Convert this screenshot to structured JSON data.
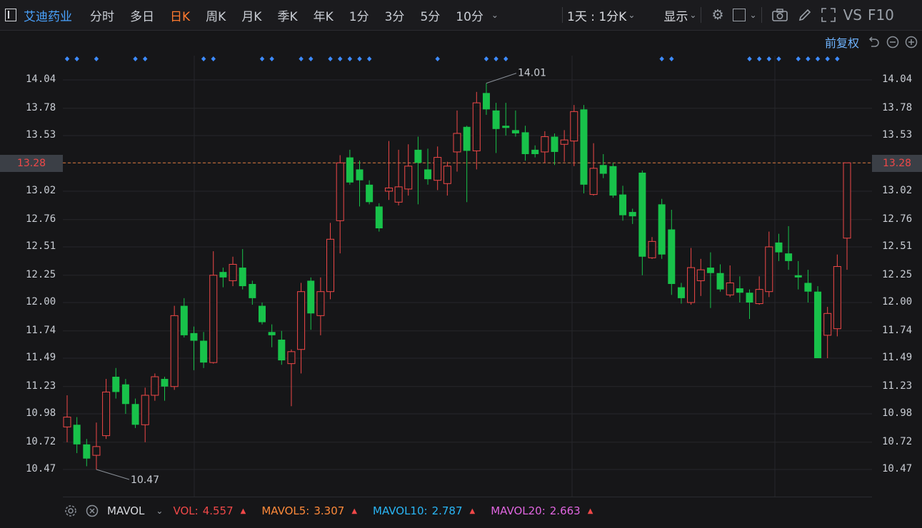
{
  "toolbar": {
    "stock_name": "艾迪药业",
    "tabs": [
      {
        "label": "分时",
        "active": false
      },
      {
        "label": "多日",
        "active": false
      },
      {
        "label": "日K",
        "active": true
      },
      {
        "label": "周K",
        "active": false
      },
      {
        "label": "月K",
        "active": false
      },
      {
        "label": "季K",
        "active": false
      },
      {
        "label": "年K",
        "active": false
      },
      {
        "label": "1分",
        "active": false
      },
      {
        "label": "3分",
        "active": false
      },
      {
        "label": "5分",
        "active": false
      },
      {
        "label": "10分",
        "active": false
      }
    ],
    "interval_select": "1天 : 1分K",
    "display_label": "显示",
    "vs_label": "VS",
    "f10_label": "F10"
  },
  "sub_toolbar": {
    "adjust_label": "前复权"
  },
  "colors": {
    "up": "#f04848",
    "down": "#18c24a",
    "accent": "#4aa3ff",
    "active_tab": "#ff7a2f",
    "dashed_line": "#e07a3c"
  },
  "chart": {
    "y_ticks": [
      "14.04",
      "13.78",
      "13.53",
      "13.28",
      "13.02",
      "12.76",
      "12.51",
      "12.25",
      "12.00",
      "11.74",
      "11.49",
      "11.23",
      "10.98",
      "10.72",
      "10.47"
    ],
    "y_min_value": 10.47,
    "y_max_value": 14.04,
    "current_price": "13.28",
    "max_annotation": "14.01",
    "min_annotation": "10.47"
  },
  "chart_data": {
    "type": "candlestick",
    "title": "",
    "ylim": [
      10.47,
      14.04
    ],
    "candles": [
      {
        "o": 10.86,
        "c": 10.95,
        "h": 11.15,
        "l": 10.72
      },
      {
        "o": 10.88,
        "c": 10.7,
        "h": 10.95,
        "l": 10.62
      },
      {
        "o": 10.7,
        "c": 10.57,
        "h": 10.75,
        "l": 10.5
      },
      {
        "o": 10.6,
        "c": 10.68,
        "h": 10.9,
        "l": 10.47
      },
      {
        "o": 10.78,
        "c": 11.18,
        "h": 11.3,
        "l": 10.75
      },
      {
        "o": 11.32,
        "c": 11.18,
        "h": 11.4,
        "l": 11.12
      },
      {
        "o": 11.25,
        "c": 11.07,
        "h": 11.3,
        "l": 10.98
      },
      {
        "o": 11.07,
        "c": 10.88,
        "h": 11.12,
        "l": 10.85
      },
      {
        "o": 10.88,
        "c": 11.15,
        "h": 11.22,
        "l": 10.72
      },
      {
        "o": 11.15,
        "c": 11.32,
        "h": 11.35,
        "l": 11.1
      },
      {
        "o": 11.3,
        "c": 11.23,
        "h": 11.32,
        "l": 11.1
      },
      {
        "o": 11.23,
        "c": 11.88,
        "h": 11.97,
        "l": 11.2
      },
      {
        "o": 11.97,
        "c": 11.7,
        "h": 12.04,
        "l": 11.68
      },
      {
        "o": 11.72,
        "c": 11.65,
        "h": 11.78,
        "l": 11.38
      },
      {
        "o": 11.65,
        "c": 11.45,
        "h": 11.73,
        "l": 11.4
      },
      {
        "o": 11.45,
        "c": 12.25,
        "h": 12.47,
        "l": 11.44
      },
      {
        "o": 12.28,
        "c": 12.23,
        "h": 12.32,
        "l": 12.14
      },
      {
        "o": 12.2,
        "c": 12.35,
        "h": 12.42,
        "l": 12.15
      },
      {
        "o": 12.32,
        "c": 12.15,
        "h": 12.49,
        "l": 12.12
      },
      {
        "o": 12.17,
        "c": 12.04,
        "h": 12.2,
        "l": 11.98
      },
      {
        "o": 11.97,
        "c": 11.82,
        "h": 12.0,
        "l": 11.8
      },
      {
        "o": 11.73,
        "c": 11.7,
        "h": 11.8,
        "l": 11.59
      },
      {
        "o": 11.66,
        "c": 11.47,
        "h": 11.74,
        "l": 11.43
      },
      {
        "o": 11.44,
        "c": 11.55,
        "h": 11.57,
        "l": 11.05
      },
      {
        "o": 11.57,
        "c": 12.1,
        "h": 12.18,
        "l": 11.35
      },
      {
        "o": 12.2,
        "c": 11.9,
        "h": 12.23,
        "l": 11.75
      },
      {
        "o": 11.88,
        "c": 12.1,
        "h": 12.23,
        "l": 11.7
      },
      {
        "o": 12.1,
        "c": 12.58,
        "h": 12.73,
        "l": 12.03
      },
      {
        "o": 12.75,
        "c": 13.28,
        "h": 13.35,
        "l": 12.45
      },
      {
        "o": 13.33,
        "c": 13.1,
        "h": 13.4,
        "l": 13.08
      },
      {
        "o": 13.22,
        "c": 13.12,
        "h": 13.3,
        "l": 12.88
      },
      {
        "o": 13.08,
        "c": 12.92,
        "h": 13.12,
        "l": 12.9
      },
      {
        "o": 12.88,
        "c": 12.68,
        "h": 12.91,
        "l": 12.65
      },
      {
        "o": 13.02,
        "c": 13.05,
        "h": 13.48,
        "l": 12.94
      },
      {
        "o": 12.92,
        "c": 13.06,
        "h": 13.4,
        "l": 12.89
      },
      {
        "o": 13.04,
        "c": 13.25,
        "h": 13.45,
        "l": 12.98
      },
      {
        "o": 13.4,
        "c": 13.28,
        "h": 13.52,
        "l": 12.9
      },
      {
        "o": 13.22,
        "c": 13.13,
        "h": 13.41,
        "l": 13.08
      },
      {
        "o": 13.12,
        "c": 13.33,
        "h": 13.43,
        "l": 13.03
      },
      {
        "o": 13.09,
        "c": 13.25,
        "h": 13.29,
        "l": 12.98
      },
      {
        "o": 13.38,
        "c": 13.55,
        "h": 13.76,
        "l": 13.2
      },
      {
        "o": 13.61,
        "c": 13.39,
        "h": 13.62,
        "l": 12.92
      },
      {
        "o": 13.39,
        "c": 13.83,
        "h": 13.93,
        "l": 13.22
      },
      {
        "o": 13.92,
        "c": 13.77,
        "h": 14.01,
        "l": 13.72
      },
      {
        "o": 13.76,
        "c": 13.59,
        "h": 13.83,
        "l": 13.37
      },
      {
        "o": 13.62,
        "c": 13.6,
        "h": 13.83,
        "l": 13.53
      },
      {
        "o": 13.58,
        "c": 13.55,
        "h": 13.76,
        "l": 13.52
      },
      {
        "o": 13.56,
        "c": 13.36,
        "h": 13.62,
        "l": 13.3
      },
      {
        "o": 13.4,
        "c": 13.36,
        "h": 13.44,
        "l": 13.33
      },
      {
        "o": 13.38,
        "c": 13.52,
        "h": 13.57,
        "l": 13.28
      },
      {
        "o": 13.52,
        "c": 13.38,
        "h": 13.55,
        "l": 13.26
      },
      {
        "o": 13.45,
        "c": 13.49,
        "h": 13.58,
        "l": 13.29
      },
      {
        "o": 13.48,
        "c": 13.75,
        "h": 13.81,
        "l": 13.25
      },
      {
        "o": 13.77,
        "c": 13.08,
        "h": 13.81,
        "l": 13.0
      },
      {
        "o": 12.99,
        "c": 13.23,
        "h": 13.46,
        "l": 12.98
      },
      {
        "o": 13.26,
        "c": 13.18,
        "h": 13.36,
        "l": 13.14
      },
      {
        "o": 13.25,
        "c": 12.98,
        "h": 13.28,
        "l": 12.96
      },
      {
        "o": 12.99,
        "c": 12.8,
        "h": 13.07,
        "l": 12.75
      },
      {
        "o": 12.83,
        "c": 12.79,
        "h": 12.86,
        "l": 12.72
      },
      {
        "o": 13.19,
        "c": 12.42,
        "h": 13.21,
        "l": 12.25
      },
      {
        "o": 12.41,
        "c": 12.56,
        "h": 12.6,
        "l": 12.4
      },
      {
        "o": 12.9,
        "c": 12.44,
        "h": 12.95,
        "l": 12.4
      },
      {
        "o": 12.67,
        "c": 12.17,
        "h": 12.85,
        "l": 12.07
      },
      {
        "o": 12.14,
        "c": 12.04,
        "h": 12.18,
        "l": 11.99
      },
      {
        "o": 12.0,
        "c": 12.32,
        "h": 12.5,
        "l": 11.98
      },
      {
        "o": 12.2,
        "c": 12.3,
        "h": 12.4,
        "l": 12.06
      },
      {
        "o": 12.32,
        "c": 12.27,
        "h": 12.46,
        "l": 11.95
      },
      {
        "o": 12.27,
        "c": 12.12,
        "h": 12.35,
        "l": 12.1
      },
      {
        "o": 12.07,
        "c": 12.18,
        "h": 12.34,
        "l": 12.05
      },
      {
        "o": 12.13,
        "c": 12.09,
        "h": 12.24,
        "l": 12.0
      },
      {
        "o": 12.09,
        "c": 12.0,
        "h": 12.12,
        "l": 11.85
      },
      {
        "o": 11.99,
        "c": 12.12,
        "h": 12.24,
        "l": 11.98
      },
      {
        "o": 12.1,
        "c": 12.51,
        "h": 12.65,
        "l": 12.05
      },
      {
        "o": 12.55,
        "c": 12.46,
        "h": 12.63,
        "l": 12.38
      },
      {
        "o": 12.45,
        "c": 12.38,
        "h": 12.7,
        "l": 12.3
      },
      {
        "o": 12.25,
        "c": 12.23,
        "h": 12.38,
        "l": 12.12
      },
      {
        "o": 12.18,
        "c": 12.1,
        "h": 12.3,
        "l": 12.0
      },
      {
        "o": 12.1,
        "c": 11.49,
        "h": 12.15,
        "l": 11.49
      },
      {
        "o": 11.7,
        "c": 11.9,
        "h": 11.96,
        "l": 11.49
      },
      {
        "o": 11.76,
        "c": 12.33,
        "h": 12.44,
        "l": 11.69
      },
      {
        "o": 12.59,
        "c": 13.28,
        "h": 13.28,
        "l": 12.3
      }
    ]
  },
  "markers": {
    "indices": [
      0,
      1,
      3,
      7,
      8,
      14,
      15,
      20,
      21,
      24,
      25,
      27,
      28,
      29,
      30,
      31,
      38,
      43,
      44,
      45,
      61,
      62,
      70,
      71,
      72,
      73,
      75,
      76,
      77,
      78,
      79
    ]
  },
  "volume_bar": {
    "indicator": "MAVOL",
    "vol_label": "VOL:",
    "vol_value": "4.557",
    "mavol5_label": "MAVOL5:",
    "mavol5_value": "3.307",
    "mavol10_label": "MAVOL10:",
    "mavol10_value": "2.787",
    "mavol20_label": "MAVOL20:",
    "mavol20_value": "2.663",
    "vol_color": "#f04848",
    "mavol5_color": "#ff8a3a",
    "mavol10_color": "#29b6f6",
    "mavol20_color": "#e066e0"
  }
}
